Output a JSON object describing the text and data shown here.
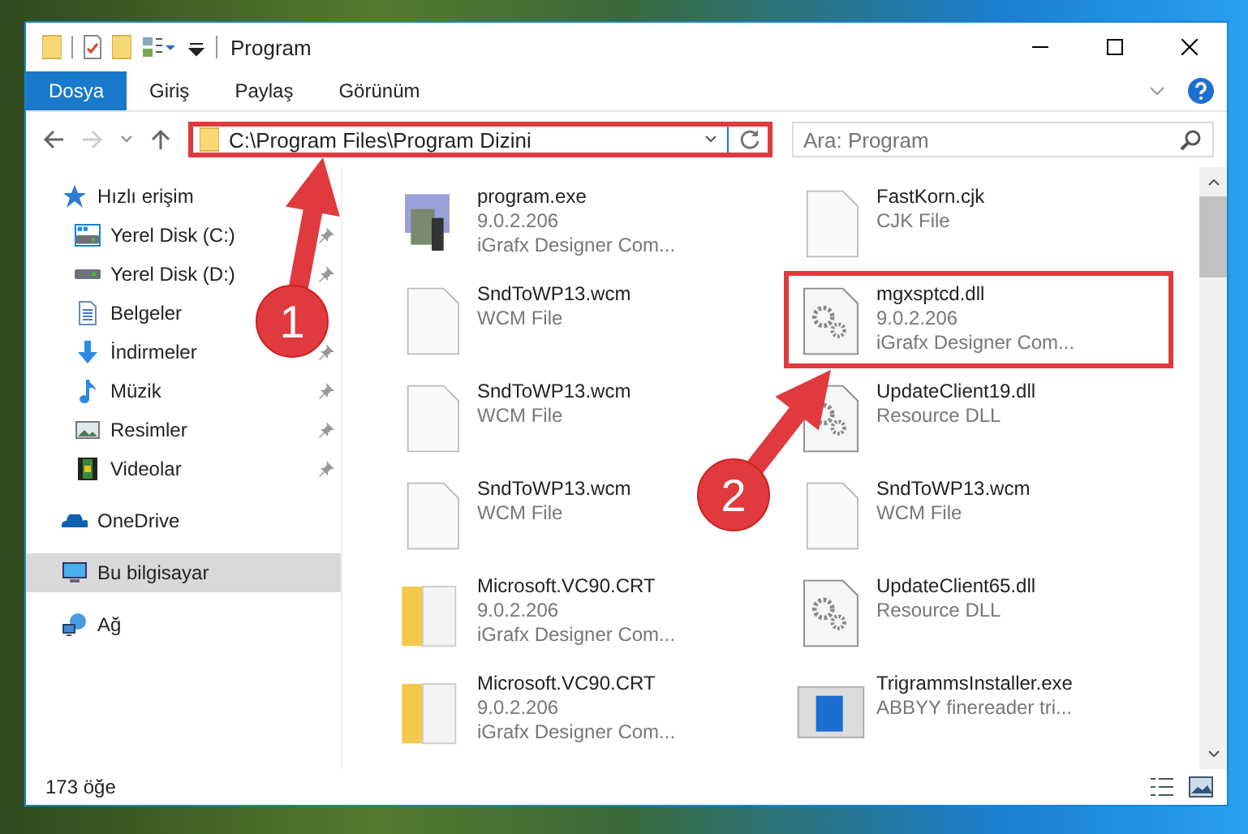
{
  "window": {
    "title": "Program"
  },
  "ribbon_tabs": [
    {
      "label": "Dosya",
      "selected": true
    },
    {
      "label": "Giriş",
      "selected": false
    },
    {
      "label": "Paylaş",
      "selected": false
    },
    {
      "label": "Görünüm",
      "selected": false
    }
  ],
  "address": {
    "path": "C:\\Program Files\\Program Dizini",
    "highlighted": true
  },
  "search": {
    "placeholder": "Ara: Program"
  },
  "sidebar": {
    "items": [
      {
        "label": "Hızlı erişim",
        "kind": "star",
        "selected": false,
        "children": [
          {
            "label": "Yerel Disk (C:)",
            "kind": "drive-win",
            "pinned": true,
            "selected": false
          },
          {
            "label": "Yerel Disk (D:)",
            "kind": "drive",
            "pinned": true,
            "selected": false
          },
          {
            "label": "Belgeler",
            "kind": "doc",
            "pinned": false,
            "selected": false
          },
          {
            "label": "İndirmeler",
            "kind": "download",
            "pinned": true,
            "selected": false
          },
          {
            "label": "Müzik",
            "kind": "music",
            "pinned": true,
            "selected": false
          },
          {
            "label": "Resimler",
            "kind": "picture",
            "pinned": true,
            "selected": false
          },
          {
            "label": "Videolar",
            "kind": "video",
            "pinned": true,
            "selected": false
          }
        ]
      },
      {
        "label": "OneDrive",
        "kind": "cloud",
        "selected": false
      },
      {
        "label": "Bu bilgisayar",
        "kind": "computer",
        "selected": true
      },
      {
        "label": "Ağ",
        "kind": "network",
        "selected": false
      }
    ]
  },
  "files": [
    {
      "name": "program.exe",
      "lines": [
        "9.0.2.206",
        "iGrafx Designer Com..."
      ],
      "kind": "exe",
      "highlighted": false
    },
    {
      "name": "FastKorn.cjk",
      "lines": [
        "CJK File"
      ],
      "kind": "blank",
      "highlighted": false
    },
    {
      "name": "SndToWP13.wcm",
      "lines": [
        "WCM File"
      ],
      "kind": "blank",
      "highlighted": false
    },
    {
      "name": "mgxsptcd.dll",
      "lines": [
        "9.0.2.206",
        "iGrafx Designer Com..."
      ],
      "kind": "dll",
      "highlighted": true
    },
    {
      "name": "SndToWP13.wcm",
      "lines": [
        "WCM File"
      ],
      "kind": "blank",
      "highlighted": false
    },
    {
      "name": "UpdateClient19.dll",
      "lines": [
        "Resource DLL"
      ],
      "kind": "dll",
      "highlighted": false
    },
    {
      "name": "SndToWP13.wcm",
      "lines": [
        "WCM File"
      ],
      "kind": "blank",
      "highlighted": false
    },
    {
      "name": "SndToWP13.wcm",
      "lines": [
        "WCM File"
      ],
      "kind": "blank",
      "highlighted": false
    },
    {
      "name": "Microsoft.VC90.CRT",
      "lines": [
        "9.0.2.206",
        "iGrafx Designer Com..."
      ],
      "kind": "folder",
      "highlighted": false
    },
    {
      "name": "UpdateClient65.dll",
      "lines": [
        "Resource DLL"
      ],
      "kind": "dll",
      "highlighted": false
    },
    {
      "name": "Microsoft.VC90.CRT",
      "lines": [
        "9.0.2.206",
        "iGrafx Designer Com..."
      ],
      "kind": "folder",
      "highlighted": false
    },
    {
      "name": "TrigrammsInstaller.exe",
      "lines": [
        "ABBYY finereader tri..."
      ],
      "kind": "installer",
      "highlighted": false
    }
  ],
  "status_bar": {
    "count": "173 öğe"
  },
  "annotations": [
    {
      "label": "1"
    },
    {
      "label": "2"
    }
  ]
}
